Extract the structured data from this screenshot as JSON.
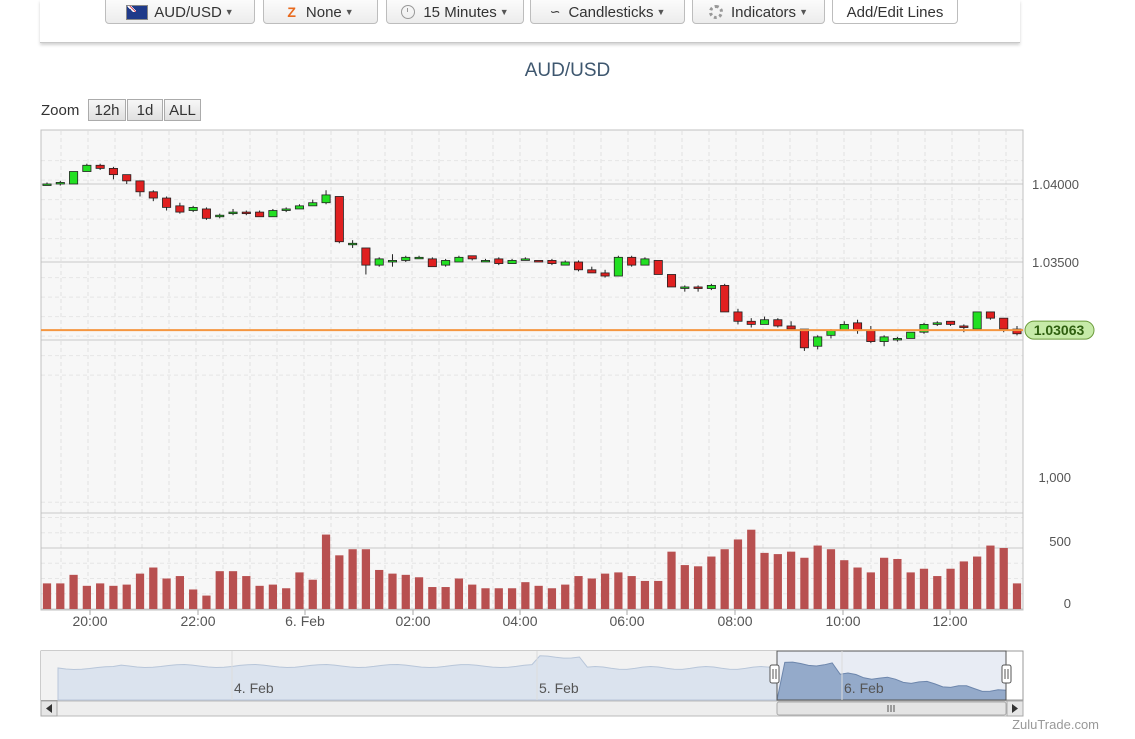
{
  "toolbar": {
    "pair_label": "AUD/USD",
    "none_label": "None",
    "interval_label": "15 Minutes",
    "chart_type_label": "Candlesticks",
    "indicators_label": "Indicators",
    "edit_lines_label": "Add/Edit Lines"
  },
  "zoom": {
    "label": "Zoom",
    "buttons": [
      "12h",
      "1d",
      "ALL"
    ]
  },
  "watermark": "ZuluTrade.com",
  "navigator": {
    "labels": [
      "4. Feb",
      "5. Feb",
      "6. Feb"
    ]
  },
  "colors": {
    "up": "#22e022",
    "down": "#e02020",
    "volume": "#b85050",
    "current_line": "#f59640",
    "current_label_bg": "#c6eaa8"
  },
  "chart_data": {
    "type": "candlestick",
    "title": "AUD/USD",
    "interval_minutes": 15,
    "x_ticks": [
      "20:00",
      "22:00",
      "6. Feb",
      "02:00",
      "04:00",
      "06:00",
      "08:00",
      "10:00",
      "12:00"
    ],
    "price_axis": {
      "ticks": [
        1.04,
        1.035
      ],
      "range": [
        1.027,
        1.0415
      ]
    },
    "volume_axis": {
      "ticks": [
        1000,
        500,
        0
      ],
      "range": [
        0,
        1000
      ]
    },
    "current_price": 1.03063,
    "current_price_label": "1.03063",
    "price_ohlc": [
      [
        1.04,
        1.0401,
        1.0399,
        1.04
      ],
      [
        1.04,
        1.0402,
        1.0399,
        1.0401
      ],
      [
        1.04,
        1.0408,
        1.04,
        1.0408
      ],
      [
        1.0408,
        1.0413,
        1.0408,
        1.0412
      ],
      [
        1.0412,
        1.0413,
        1.0409,
        1.041
      ],
      [
        1.041,
        1.0411,
        1.0403,
        1.0406
      ],
      [
        1.0406,
        1.0406,
        1.04,
        1.0402
      ],
      [
        1.0402,
        1.0402,
        1.0392,
        1.0395
      ],
      [
        1.0395,
        1.0396,
        1.0389,
        1.0391
      ],
      [
        1.0391,
        1.0392,
        1.0383,
        1.0385
      ],
      [
        1.0386,
        1.0388,
        1.0381,
        1.0382
      ],
      [
        1.0383,
        1.0386,
        1.0382,
        1.0385
      ],
      [
        1.0384,
        1.0385,
        1.0377,
        1.0378
      ],
      [
        1.0379,
        1.0381,
        1.0378,
        1.038
      ],
      [
        1.0381,
        1.0384,
        1.038,
        1.0382
      ],
      [
        1.0382,
        1.0383,
        1.038,
        1.0381
      ],
      [
        1.0382,
        1.0383,
        1.0379,
        1.0379
      ],
      [
        1.0379,
        1.0384,
        1.0379,
        1.0383
      ],
      [
        1.0383,
        1.0385,
        1.0382,
        1.0384
      ],
      [
        1.0384,
        1.0387,
        1.0384,
        1.0386
      ],
      [
        1.0386,
        1.039,
        1.0386,
        1.0388
      ],
      [
        1.0388,
        1.0396,
        1.0387,
        1.0393
      ],
      [
        1.0392,
        1.0392,
        1.0362,
        1.0363
      ],
      [
        1.0362,
        1.0364,
        1.0359,
        1.0362
      ],
      [
        1.0359,
        1.0359,
        1.0342,
        1.0348
      ],
      [
        1.0348,
        1.0353,
        1.0347,
        1.0352
      ],
      [
        1.035,
        1.0355,
        1.0347,
        1.0351
      ],
      [
        1.0351,
        1.0354,
        1.035,
        1.0353
      ],
      [
        1.0353,
        1.0354,
        1.0352,
        1.0353
      ],
      [
        1.0352,
        1.0353,
        1.0347,
        1.0347
      ],
      [
        1.0348,
        1.0352,
        1.0347,
        1.0351
      ],
      [
        1.035,
        1.0354,
        1.035,
        1.0353
      ],
      [
        1.0354,
        1.0354,
        1.0351,
        1.0352
      ],
      [
        1.0351,
        1.0352,
        1.035,
        1.0351
      ],
      [
        1.0352,
        1.0353,
        1.0348,
        1.0349
      ],
      [
        1.0349,
        1.0352,
        1.0349,
        1.0351
      ],
      [
        1.0351,
        1.0353,
        1.0351,
        1.0352
      ],
      [
        1.0351,
        1.0351,
        1.035,
        1.035
      ],
      [
        1.0351,
        1.0352,
        1.0348,
        1.0349
      ],
      [
        1.0348,
        1.0351,
        1.0348,
        1.035
      ],
      [
        1.035,
        1.0351,
        1.0344,
        1.0345
      ],
      [
        1.0345,
        1.0347,
        1.0343,
        1.0343
      ],
      [
        1.0343,
        1.0345,
        1.034,
        1.0341
      ],
      [
        1.0341,
        1.0354,
        1.0341,
        1.0353
      ],
      [
        1.0353,
        1.0354,
        1.0347,
        1.0348
      ],
      [
        1.0348,
        1.0353,
        1.0348,
        1.0352
      ],
      [
        1.0351,
        1.0351,
        1.0342,
        1.0342
      ],
      [
        1.0342,
        1.0342,
        1.0334,
        1.0334
      ],
      [
        1.0334,
        1.0335,
        1.0331,
        1.0334
      ],
      [
        1.0334,
        1.0335,
        1.0331,
        1.0333
      ],
      [
        1.0333,
        1.0336,
        1.0332,
        1.0335
      ],
      [
        1.0335,
        1.0336,
        1.0321,
        1.0318
      ],
      [
        1.0318,
        1.032,
        1.031,
        1.0312
      ],
      [
        1.0312,
        1.0314,
        1.0308,
        1.031
      ],
      [
        1.031,
        1.0315,
        1.031,
        1.0313
      ],
      [
        1.0313,
        1.0314,
        1.0308,
        1.0309
      ],
      [
        1.0309,
        1.0312,
        1.0306,
        1.0307
      ],
      [
        1.0307,
        1.0307,
        1.0293,
        1.0295
      ],
      [
        1.0296,
        1.0303,
        1.0294,
        1.0302
      ],
      [
        1.0303,
        1.0307,
        1.0301,
        1.0306
      ],
      [
        1.0306,
        1.0312,
        1.0306,
        1.031
      ],
      [
        1.0311,
        1.0313,
        1.0304,
        1.0306
      ],
      [
        1.0306,
        1.0309,
        1.0298,
        1.0299
      ],
      [
        1.0299,
        1.0303,
        1.0296,
        1.0302
      ],
      [
        1.03,
        1.0302,
        1.0299,
        1.0301
      ],
      [
        1.0301,
        1.0305,
        1.0301,
        1.0305
      ],
      [
        1.0305,
        1.0311,
        1.0304,
        1.031
      ],
      [
        1.031,
        1.0312,
        1.0309,
        1.0311
      ],
      [
        1.0312,
        1.0312,
        1.0309,
        1.031
      ],
      [
        1.0309,
        1.031,
        1.0305,
        1.0308
      ],
      [
        1.0307,
        1.0318,
        1.0307,
        1.0318
      ],
      [
        1.0318,
        1.0318,
        1.0313,
        1.0314
      ],
      [
        1.0314,
        1.0314,
        1.0305,
        1.0307
      ],
      [
        1.0307,
        1.0309,
        1.0303,
        1.0304
      ]
    ],
    "volume": [
      210,
      210,
      280,
      190,
      210,
      190,
      200,
      290,
      340,
      250,
      270,
      160,
      110,
      310,
      310,
      270,
      190,
      200,
      170,
      300,
      240,
      610,
      440,
      490,
      490,
      320,
      290,
      280,
      260,
      180,
      180,
      250,
      200,
      170,
      170,
      170,
      220,
      190,
      170,
      200,
      270,
      250,
      290,
      300,
      270,
      230,
      230,
      470,
      360,
      350,
      430,
      490,
      570,
      650,
      460,
      450,
      470,
      420,
      520,
      490,
      400,
      340,
      300,
      420,
      410,
      300,
      330,
      270,
      330,
      390,
      430,
      520,
      500,
      210
    ]
  }
}
